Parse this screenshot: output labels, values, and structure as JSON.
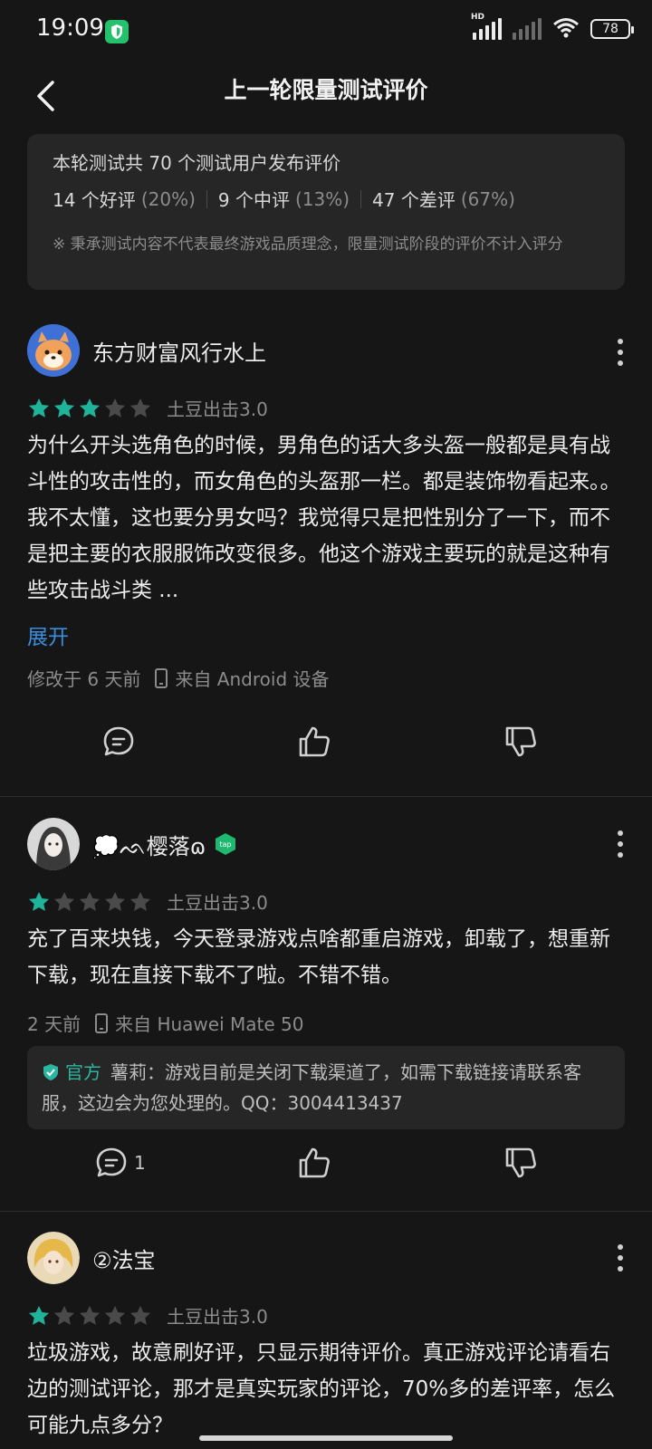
{
  "status_bar": {
    "time": "19:09",
    "hd_label": "HD",
    "battery": "78",
    "icons": [
      "shield-icon",
      "signal-icon",
      "signal-icon",
      "wifi-icon",
      "battery-icon"
    ]
  },
  "header": {
    "title": "上一轮限量测试评价",
    "back_icon": "chevron-left-icon"
  },
  "summary": {
    "line1": "本轮测试共 70 个测试用户发布评价",
    "good": "14 个好评",
    "good_pct": "(20%)",
    "mid": "9 个中评",
    "mid_pct": "(13%)",
    "bad": "47 个差评",
    "bad_pct": "(67%)",
    "note": "※ 秉承测试内容不代表最终游戏品质理念，限量测试阶段的评价不计入评分"
  },
  "colors": {
    "star_filled": "#1fb39a",
    "star_empty": "#4a4a4a",
    "link": "#3a8ee0",
    "official": "#2ab6a0"
  },
  "reviews": [
    {
      "username": "东方财富风行水上",
      "rating": 3,
      "device_model": "土豆出击3.0",
      "text": "为什么开头选角色的时候，男角色的话大多头盔一般都是具有战斗性的攻击性的，而女角色的头盔那一栏。都是装饰物看起来。。我不太懂，这也要分男女吗？我觉得只是把性别分了一下，而不是把主要的衣服服饰改变很多。他这个游戏主要玩的就是这种有些攻击战斗类 ...",
      "expand_label": "展开",
      "time": "修改于 6 天前",
      "source": "来自 Android 设备"
    },
    {
      "username": "💭ᨒ樱落ɷ",
      "rating": 1,
      "device_model": "土豆出击3.0",
      "text": "充了百来块钱，今天登录游戏点啥都重启游戏，卸载了，想重新下载，现在直接下载不了啦。不错不错。",
      "time": "2 天前",
      "source": "来自 Huawei Mate 50",
      "official_tag": "官方",
      "official_text": "薯莉：游戏目前是关闭下载渠道了，如需下载链接请联系客服，这边会为您处理的。QQ：3004413437",
      "reply_count": "1"
    },
    {
      "username": "②法宝",
      "rating": 1,
      "device_model": "土豆出击3.0",
      "text": "垃圾游戏，故意刷好评，只显示期待评价。真正游戏评论请看右边的测试评论，那才是真实玩家的评论，70%多的差评率，怎么可能九点多分？"
    }
  ]
}
